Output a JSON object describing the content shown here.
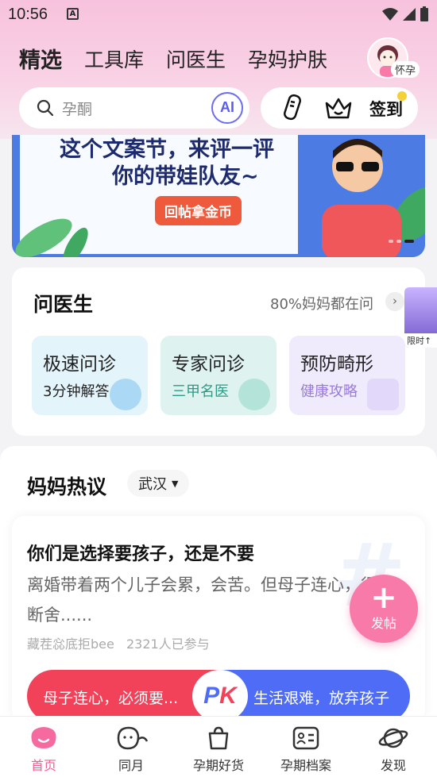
{
  "status_bar": {
    "time": "10:56"
  },
  "top_tabs": [
    {
      "label": "精选",
      "active": true
    },
    {
      "label": "工具库",
      "active": false
    },
    {
      "label": "问医生",
      "active": false
    },
    {
      "label": "孕妈护肤",
      "active": false
    }
  ],
  "profile": {
    "badge": "怀孕"
  },
  "search": {
    "placeholder": "孕酮",
    "ai_label": "AI"
  },
  "toolbar": {
    "signin_label": "签到"
  },
  "banner": {
    "line1": "这个文案节，来评一评",
    "line2": "你的带娃队友~",
    "button": "回帖拿金币"
  },
  "doctor": {
    "title": "问医生",
    "subtitle": "80%妈妈都在问",
    "services": [
      {
        "title": "极速问诊",
        "subtitle": "3分钟解答",
        "bg": "#e4f4fb",
        "sub_color": "#222"
      },
      {
        "title": "专家问诊",
        "subtitle": "三甲名医",
        "bg": "#def3f0",
        "sub_color": "#2e9a86"
      },
      {
        "title": "预防畸形",
        "subtitle": "健康攻略",
        "bg": "#efeafc",
        "sub_color": "#9a7cd8"
      }
    ]
  },
  "ad": {
    "label": "限时↑"
  },
  "hot": {
    "title": "妈妈热议",
    "city": "武汉",
    "post": {
      "title": "你们是选择要孩子，还是不要",
      "body": "离婚带着两个儿子会累，会苦。但母子连心，很难断舍......",
      "author": "藏茬惢底拒bee",
      "participants": "2321人已参与"
    },
    "pk": {
      "left": "母子连心，必须要...",
      "right": "生活艰难，放弃孩子"
    }
  },
  "fab": {
    "label": "发帖"
  },
  "bottom_nav": [
    {
      "label": "首页",
      "active": true
    },
    {
      "label": "同月",
      "active": false
    },
    {
      "label": "孕期好货",
      "active": false
    },
    {
      "label": "孕期档案",
      "active": false
    },
    {
      "label": "发现",
      "active": false
    }
  ],
  "colors": {
    "accent": "#f15d92",
    "ai_blue": "#5b5bf0",
    "pk_red": "#f2425a",
    "pk_blue": "#4e6cf5"
  }
}
